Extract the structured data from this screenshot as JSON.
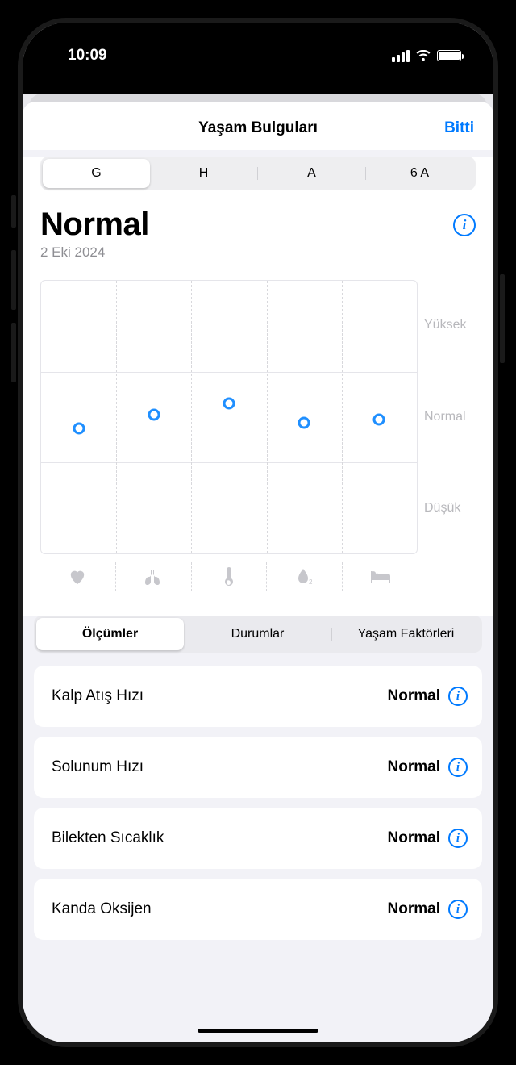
{
  "status": {
    "time": "10:09"
  },
  "nav": {
    "title": "Yaşam Bulguları",
    "done": "Bitti"
  },
  "time_range": {
    "items": [
      "G",
      "H",
      "A",
      "6 A"
    ],
    "active_index": 0
  },
  "summary": {
    "status": "Normal",
    "date": "2 Eki 2024"
  },
  "chart_data": {
    "type": "scatter",
    "ylabels": [
      "Yüksek",
      "Normal",
      "Düşük"
    ],
    "x_icons": [
      "heart-icon",
      "lungs-icon",
      "thermometer-icon",
      "oxygen-icon",
      "bed-icon"
    ],
    "points": [
      {
        "x": 0,
        "y": 0.46
      },
      {
        "x": 1,
        "y": 0.51
      },
      {
        "x": 2,
        "y": 0.55
      },
      {
        "x": 3,
        "y": 0.48
      },
      {
        "x": 4,
        "y": 0.49
      }
    ],
    "ylim": [
      0,
      1
    ]
  },
  "section_tabs": {
    "items": [
      "Ölçümler",
      "Durumlar",
      "Yaşam Faktörleri"
    ],
    "active_index": 0
  },
  "metrics": [
    {
      "name": "Kalp Atış Hızı",
      "value": "Normal"
    },
    {
      "name": "Solunum Hızı",
      "value": "Normal"
    },
    {
      "name": "Bilekten Sıcaklık",
      "value": "Normal"
    },
    {
      "name": "Kanda Oksijen",
      "value": "Normal"
    }
  ]
}
